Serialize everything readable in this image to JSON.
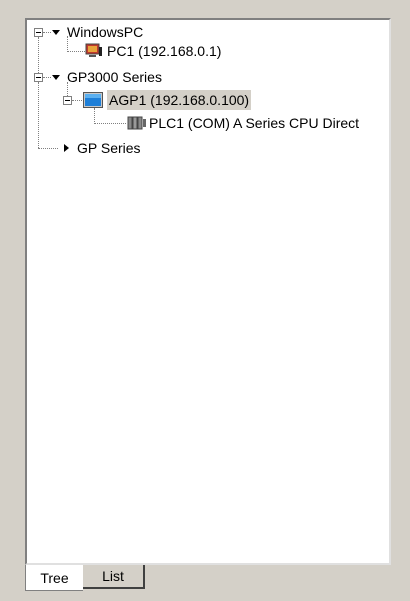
{
  "tree": {
    "nodes": [
      {
        "label": "WindowsPC",
        "icon": "triangle-down-icon"
      },
      {
        "label": "PC1 (192.168.0.1)",
        "icon": "pc-icon"
      },
      {
        "label": "GP3000 Series",
        "icon": "triangle-down-icon"
      },
      {
        "label": "AGP1 (192.168.0.100)",
        "icon": "display-unit-icon",
        "selected": true
      },
      {
        "label": "PLC1 (COM) A Series CPU Direct",
        "icon": "plc-icon"
      },
      {
        "label": "GP Series",
        "icon": "triangle-right-icon"
      }
    ]
  },
  "tabs": [
    {
      "label": "Tree",
      "active": true
    },
    {
      "label": "List",
      "active": false
    }
  ],
  "colors": {
    "panel_bg": "#d4d0c8",
    "tree_bg": "#ffffff",
    "selection_bg": "#d4d0c8",
    "agp_icon": "#1e7fd8",
    "pc_icon": "#c0392b"
  }
}
